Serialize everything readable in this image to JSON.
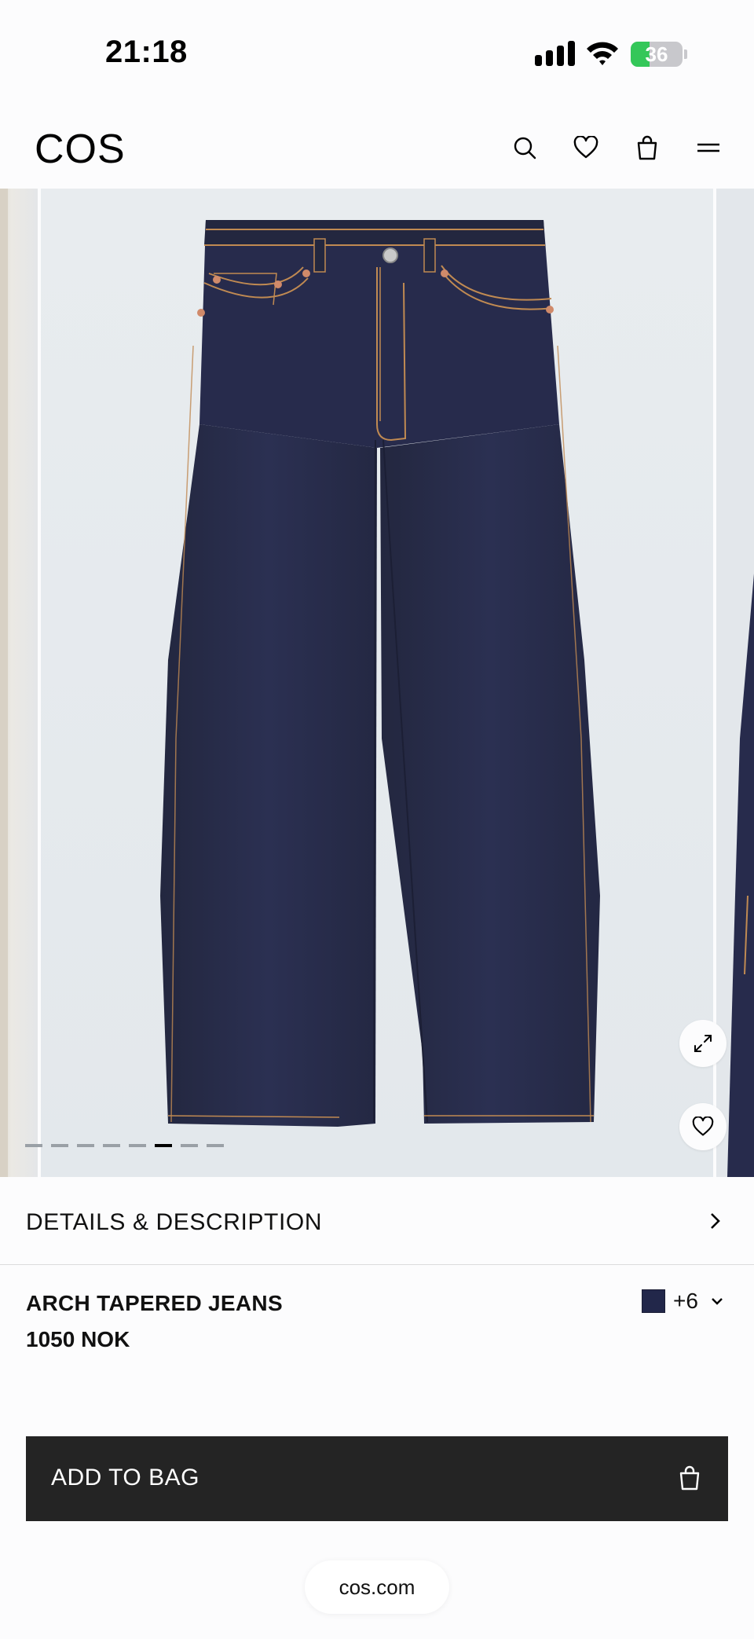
{
  "status_bar": {
    "time": "21:18",
    "battery": "36",
    "battery_level": 0.36,
    "icons": [
      "signal-icon",
      "wifi-icon",
      "battery-charging-icon"
    ]
  },
  "header": {
    "logo": "COS",
    "icons": [
      "search-icon",
      "heart-icon",
      "bag-icon",
      "menu-icon"
    ]
  },
  "gallery": {
    "slide_count": 8,
    "active_index": 5,
    "subject": "dark indigo denim tapered jeans",
    "colors": {
      "denim": "#272b4c",
      "stitch": "#c08a52",
      "background": "#e6eaee"
    }
  },
  "details": {
    "label": "DETAILS & DESCRIPTION"
  },
  "product": {
    "name": "ARCH TAPERED JEANS",
    "price": "1050 NOK",
    "swatch_color": "#22274a",
    "more_colors": "+6"
  },
  "cta": {
    "label": "ADD TO BAG"
  },
  "browser": {
    "url": "cos.com"
  }
}
